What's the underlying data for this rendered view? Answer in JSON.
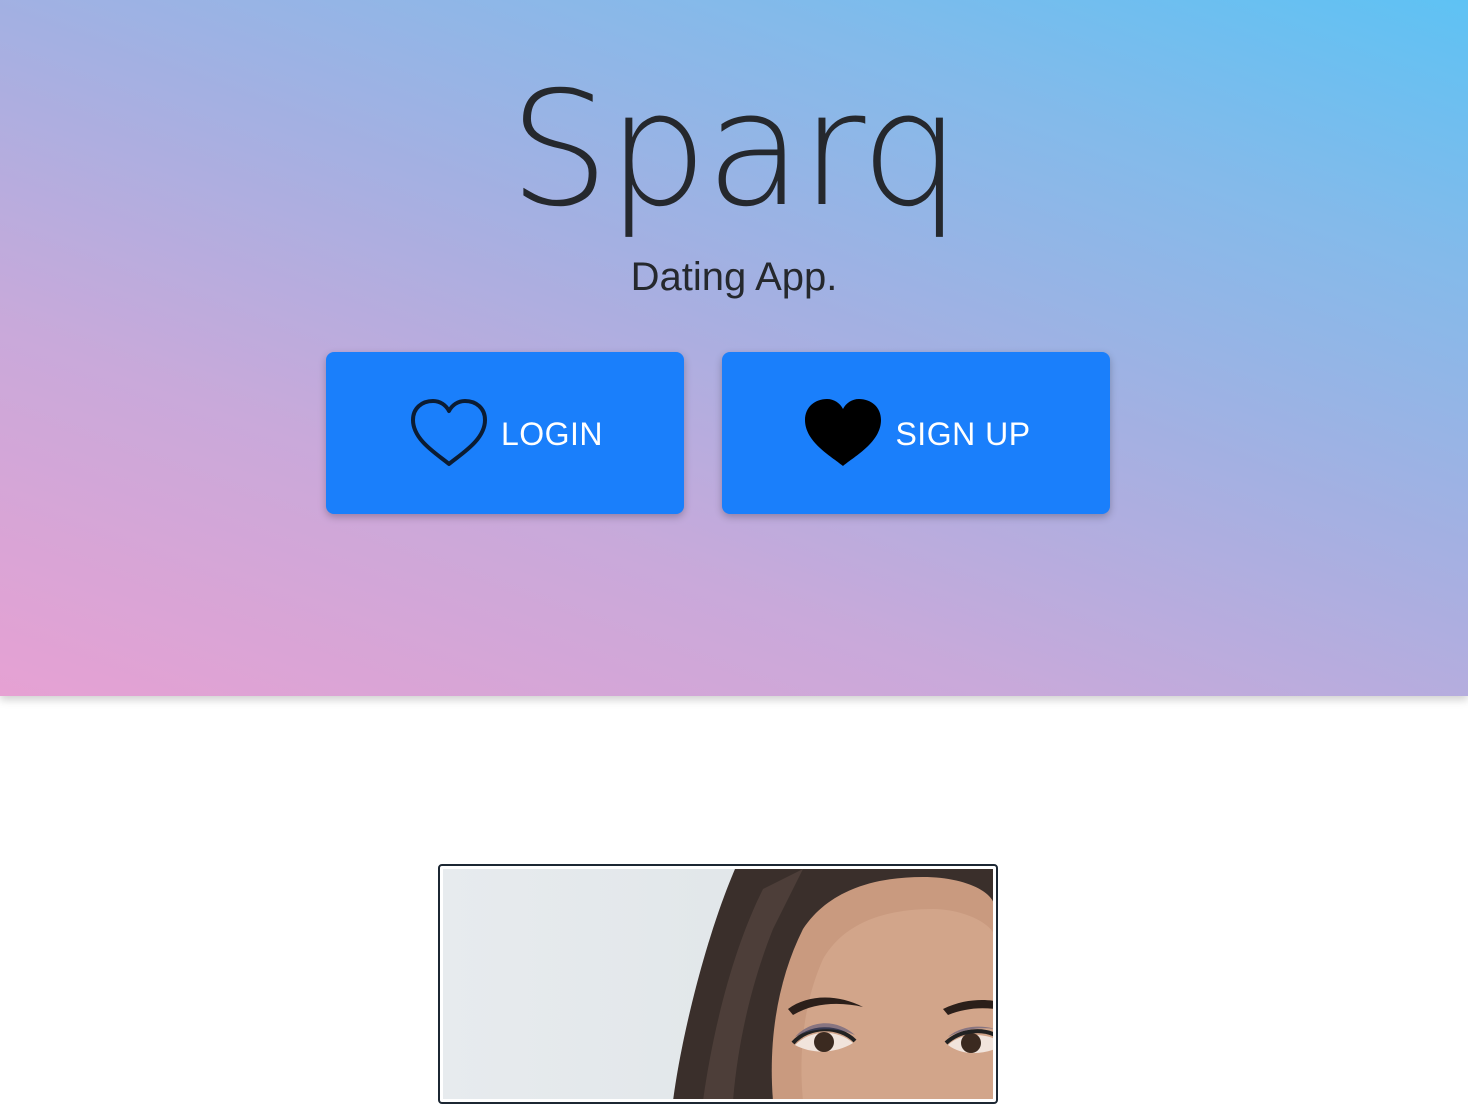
{
  "app": {
    "title": "Sparq",
    "tagline": "Dating App."
  },
  "buttons": {
    "login": {
      "label": "LOGIN",
      "icon": "heart-outline-icon"
    },
    "signup": {
      "label": "SIGN UP",
      "icon": "heart-filled-icon"
    }
  },
  "colors": {
    "gradient_start": "#e6a1d3",
    "gradient_end": "#5ec2f4",
    "button": "#1a7ffb",
    "text": "#25282d"
  },
  "profile": {
    "photo": "profile-photo"
  }
}
